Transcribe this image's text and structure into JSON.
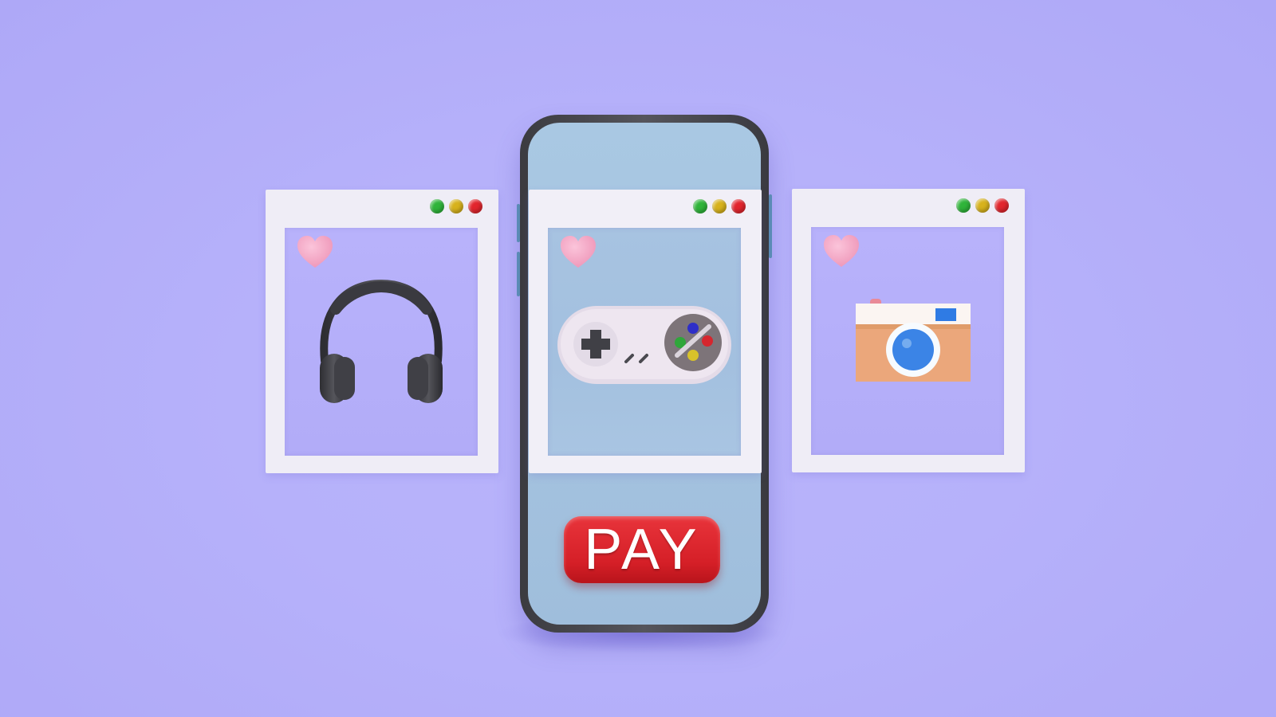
{
  "pay_button": {
    "label": "PAY"
  },
  "windows": [
    {
      "product_icon": "headphones-icon"
    },
    {
      "product_icon": "gamepad-icon"
    },
    {
      "product_icon": "camera-icon"
    }
  ],
  "window_controls": [
    "green-dot",
    "yellow-dot",
    "red-dot"
  ],
  "colors": {
    "background": "#b8b3fa",
    "phone_body": "#45454b",
    "phone_screen": "#a7c5e1",
    "window_frame": "#efedf6",
    "pay_button": "#dc262e",
    "heart": "#f3a9c6",
    "dot_green": "#2fb43a",
    "dot_yellow": "#d7b21c",
    "dot_red": "#e2252d"
  }
}
